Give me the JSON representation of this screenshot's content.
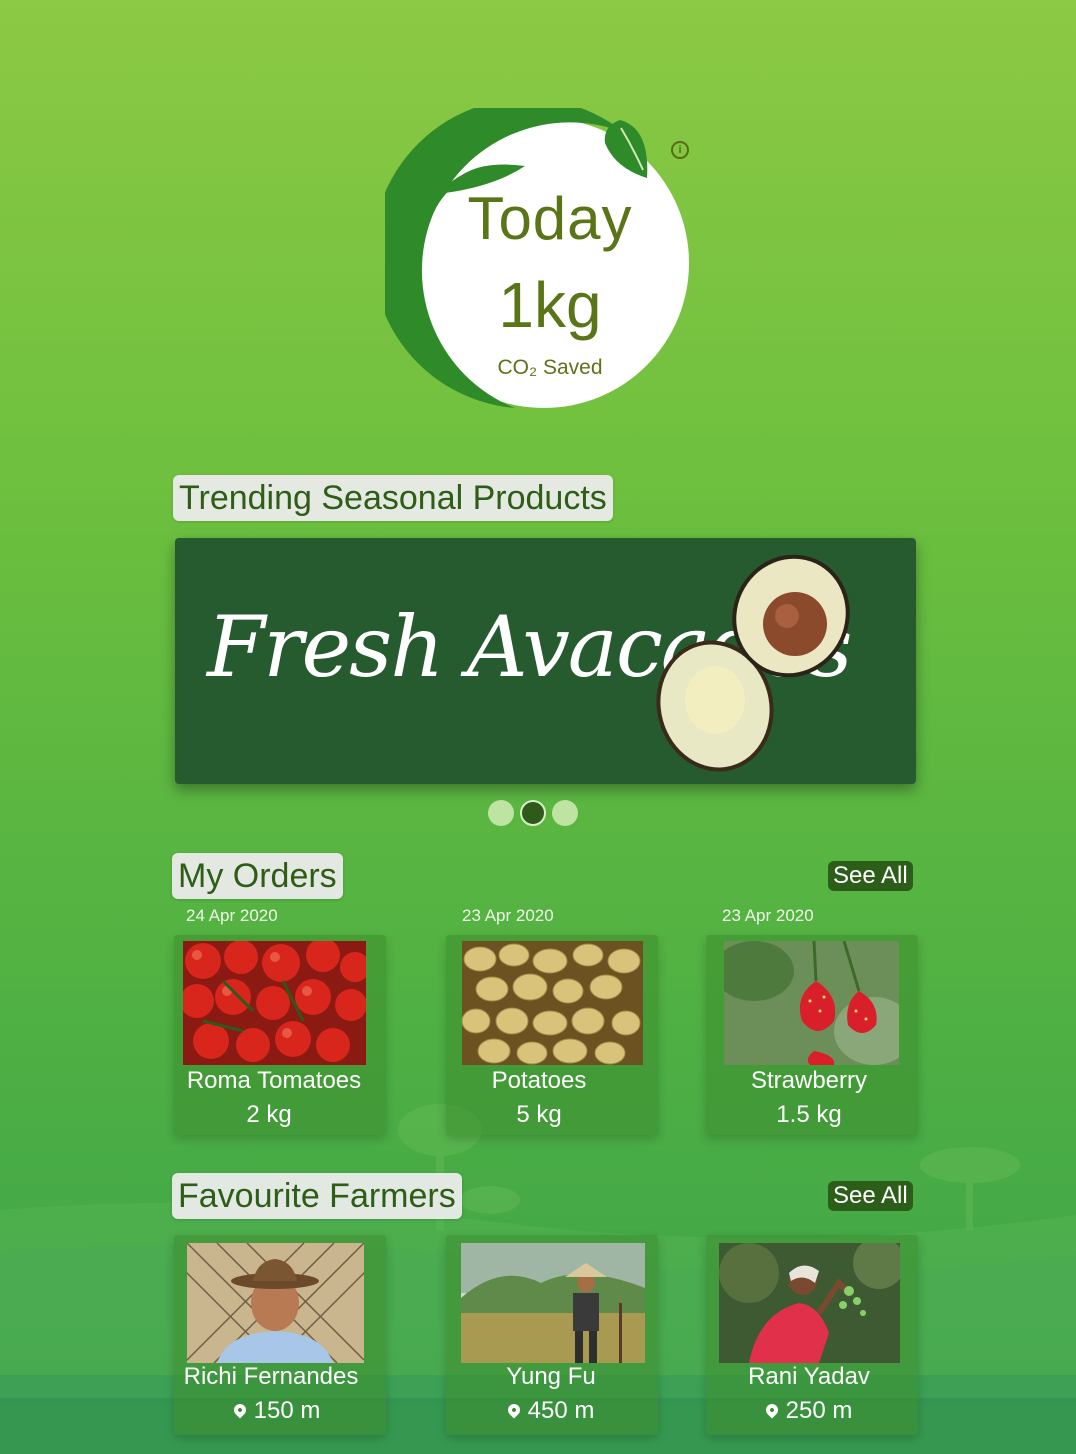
{
  "co2": {
    "period": "Today",
    "amount": "1kg",
    "label": "CO₂ Saved",
    "info_icon": "info-icon"
  },
  "trending": {
    "title": "Trending Seasonal Products",
    "banner_text": "Fresh Avacados",
    "carousel": {
      "pages": 3,
      "active_page": 2
    }
  },
  "orders": {
    "title": "My Orders",
    "see_all": "See All",
    "items": [
      {
        "date": "24 Apr 2020",
        "name": "Roma Tomatoes",
        "qty": "2 kg"
      },
      {
        "date": "23 Apr 2020",
        "name": "Potatoes",
        "qty": "5 kg"
      },
      {
        "date": "23 Apr 2020",
        "name": "Strawberry",
        "qty": "1.5 kg"
      }
    ]
  },
  "farmers": {
    "title": "Favourite Farmers",
    "see_all": "See All",
    "items": [
      {
        "name": "Richi Fernandes",
        "distance": "150 m"
      },
      {
        "name": "Yung Fu",
        "distance": "450 m"
      },
      {
        "name": "Rani Yadav",
        "distance": "250 m"
      }
    ]
  },
  "colors": {
    "background_top": "#8cc944",
    "background_bottom": "#3aa24a",
    "banner": "#255b2e",
    "accent_dark": "#2c5e1a",
    "badge_text": "#5a7418"
  }
}
